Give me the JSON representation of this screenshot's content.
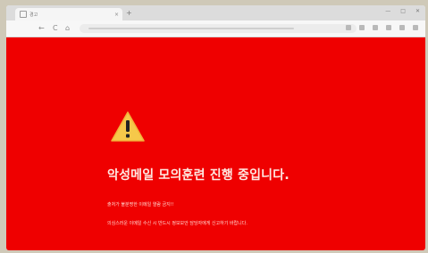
{
  "browser": {
    "tab_title": "경고",
    "tab_close": "×",
    "new_tab": "+",
    "window_controls": [
      "—",
      "□",
      "✕"
    ],
    "nav": {
      "back": "←",
      "refresh": "C",
      "home": "⌂"
    }
  },
  "page": {
    "background": "#ef0000",
    "icon": "warning-triangle-icon",
    "headline": "악성메일 모의훈련 진행 중입니다.",
    "line1": "출처가 불분명한 이메일 열람 금지!!",
    "line2": "의심스러운 이메일 수신 시 반드시 정보보안 담당자에게 신고하기 바랍니다."
  }
}
